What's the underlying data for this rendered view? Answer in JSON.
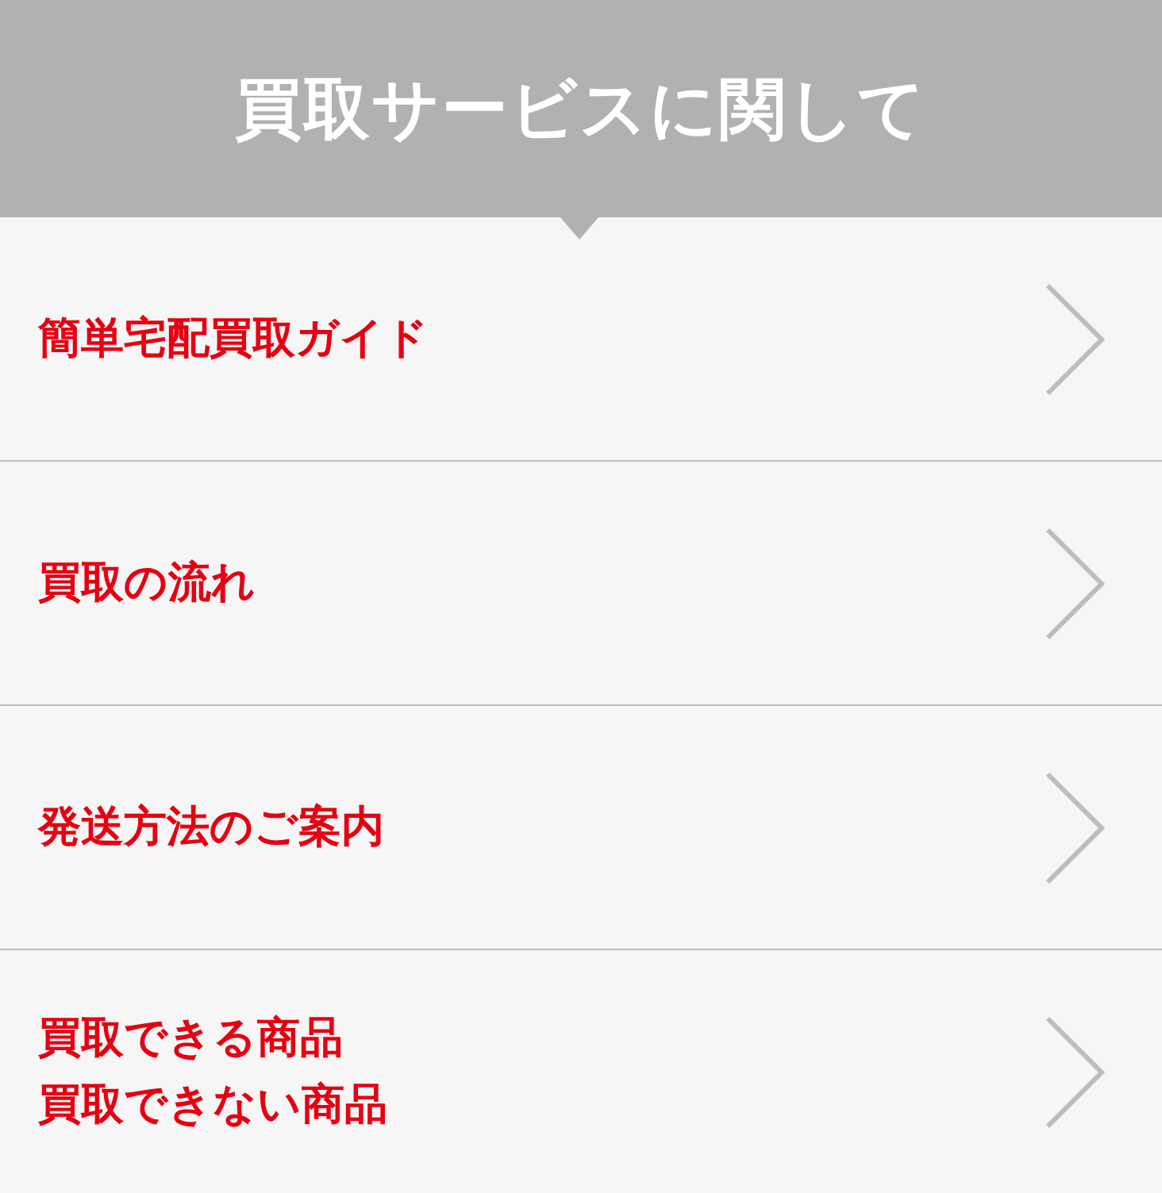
{
  "header": {
    "title": "買取サービスに関して"
  },
  "menu_items": [
    {
      "lines": [
        "簡単宅配買取ガイド"
      ]
    },
    {
      "lines": [
        "買取の流れ"
      ]
    },
    {
      "lines": [
        "発送方法のご案内"
      ]
    },
    {
      "lines": [
        "買取できる商品",
        "買取できない商品"
      ]
    }
  ]
}
